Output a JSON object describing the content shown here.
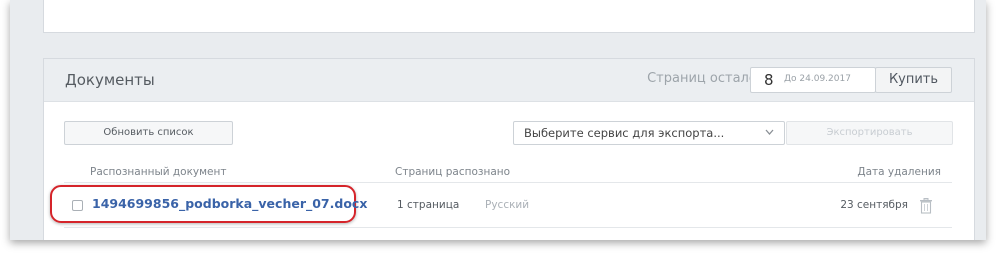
{
  "panel": {
    "title": "Документы",
    "pages_left_label": "Страниц осталось:",
    "pages_count": "8",
    "pages_until": "До 24.09.2017",
    "buy_label": "Купить"
  },
  "toolbar": {
    "refresh_label": "Обновить список",
    "export_placeholder": "Выберите сервис для экспорта...",
    "export_label": "Экспортировать"
  },
  "table": {
    "headers": [
      "Распознанный документ",
      "Страниц распознано",
      "Дата удаления"
    ],
    "rows": [
      {
        "filename": "1494699856_podborka_vecher_07.docx",
        "pages": "1 страница",
        "language": "Русский",
        "delete_date": "23 сентября"
      }
    ]
  },
  "colors": {
    "highlight": "#d5242a",
    "link": "#3a63a8",
    "background": "#e9ecef"
  },
  "icons": [
    "chevron-down-icon",
    "trash-icon"
  ]
}
